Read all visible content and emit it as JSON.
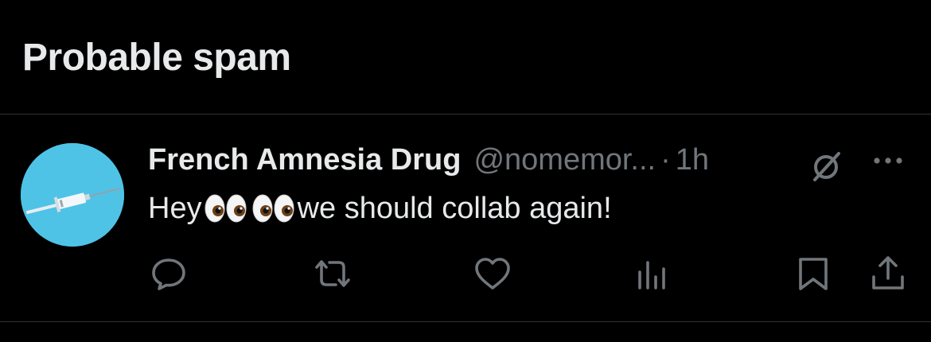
{
  "section": {
    "title": "Probable spam"
  },
  "tweet": {
    "display_name": "French Amnesia Drug",
    "handle": "@nomemor...",
    "separator": "·",
    "time": "1h",
    "text_before": "Hey ",
    "text_after": "we should collab again!",
    "emoji": "eyes"
  },
  "icons": {
    "avatar": "syringe-avatar",
    "muted": "muted-circle-slash-icon",
    "more": "more-horizontal-icon",
    "actions": [
      "reply-icon",
      "retweet-icon",
      "like-icon",
      "views-icon",
      "bookmark-icon",
      "share-icon"
    ]
  },
  "colors": {
    "background": "#000000",
    "text_primary": "#e7e9ea",
    "text_secondary": "#71767b",
    "divider": "#2f3336",
    "avatar_bg": "#4fc3e6"
  }
}
